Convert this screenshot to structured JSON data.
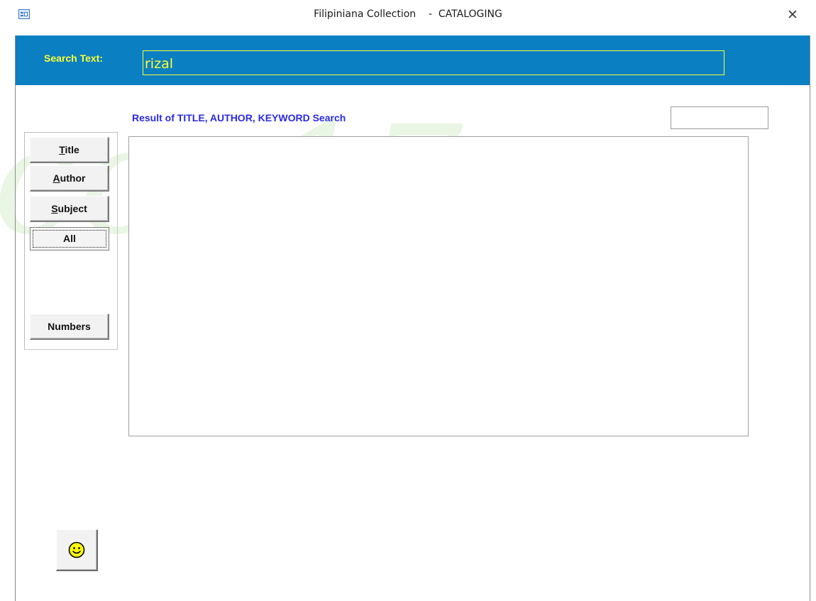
{
  "window": {
    "title": "Filipiniana Collection    -  CATALOGING",
    "close_symbol": "✕"
  },
  "search": {
    "label": "Search Text:",
    "value": "rizal"
  },
  "results": {
    "label": "Result of TITLE, AUTHOR, KEYWORD Search",
    "side_box_value": "",
    "items": []
  },
  "buttons": {
    "title": {
      "mnemonic": "T",
      "rest": "itle"
    },
    "author": {
      "mnemonic": "A",
      "rest": "uthor"
    },
    "subject": {
      "mnemonic": "S",
      "rest": "ubject"
    },
    "all": "All",
    "numbers": "Numbers"
  },
  "watermark": "con17",
  "icons": {
    "app": "form-icon",
    "close": "close-icon",
    "smiley": "smiley-icon"
  },
  "colors": {
    "header_bg": "#0a7fc2",
    "header_text": "#ffff33",
    "result_label": "#2a2ae6",
    "watermark": "#78c85a"
  }
}
